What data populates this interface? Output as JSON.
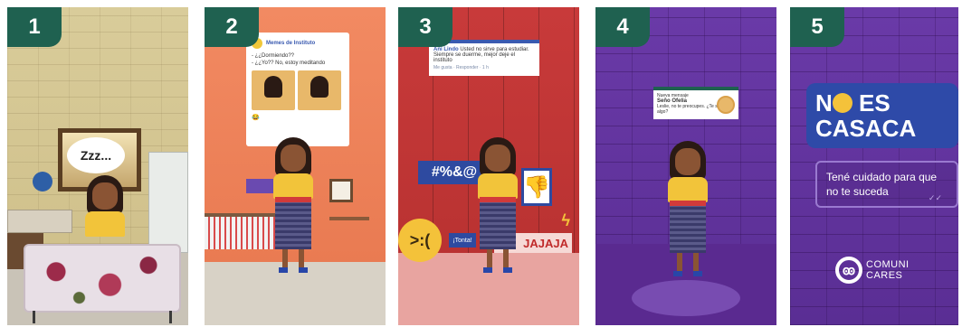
{
  "panels": [
    {
      "number": "1",
      "bubble": "Zzz..."
    },
    {
      "number": "2",
      "post": {
        "author": "Memes de Instituto",
        "lines": [
          "- ¿¿Dormiendo??",
          "- ¿¿Yo?? No, estoy meditando"
        ],
        "emoji": "😂"
      }
    },
    {
      "number": "3",
      "post": {
        "author": "Ani Lindo",
        "text": "Usted no sirve para estudiar. Siempre se duerme, mejor deje el instituto",
        "footer": "Me gusta · Responder · 1 h"
      },
      "symbols": "#%&@",
      "tag": "¡Tonta!",
      "laugh": "JAJAJA"
    },
    {
      "number": "4",
      "post": {
        "header": "Nueva mensaje",
        "author": "Seño Ofelia",
        "text": "Leslie, no te preocupes. ¿Te sucede algo?"
      }
    },
    {
      "number": "5",
      "title_line1_a": "N",
      "title_line1_b": "ES",
      "title_line2": "CASACA",
      "tagline": "Tené cuidado para que no te suceda",
      "ticks": "✓✓",
      "logo_line1": "COMUNI",
      "logo_line2": "CARES"
    }
  ],
  "colors": {
    "badge": "#1f6150",
    "panel3_wall": "#c83a3a",
    "panel4_wall": "#5a2e94",
    "title_box": "#2e4aa8"
  }
}
